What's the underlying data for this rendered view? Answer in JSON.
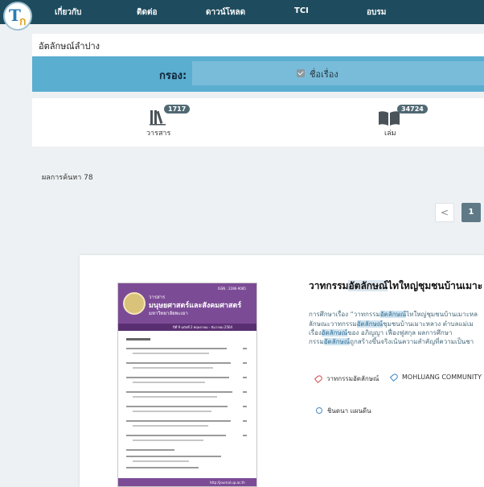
{
  "nav": {
    "items": [
      "เกี่ยวกับ",
      "ติดต่อ",
      "ดาวน์โหลด",
      "TCI",
      "อบรม"
    ]
  },
  "breadcrumb": "อัตลักษณ์ลำปาง",
  "filter": {
    "label": "กรอง:",
    "option": "ชื่อเรื่อง"
  },
  "categories": [
    {
      "label": "วารสาร",
      "count": "1717",
      "icon": "books-icon"
    },
    {
      "label": "เล่ม",
      "count": "34724",
      "icon": "open-book-icon"
    }
  ],
  "results": {
    "count_text": "ผลการค้นหา 78"
  },
  "pagination": {
    "prev": "<",
    "current": "1"
  },
  "cover": {
    "issn": "ISSN : 2286-9085",
    "line1": "วารสาร",
    "line2": "มนุษยศาสตร์และสังคมศาสตร์",
    "line3": "มหาวิทยาลัยพะเยา",
    "issue": "ปีที่ 9 ฉบับที่ 2 พฤษภาคม - ธันวาคม 2564",
    "footer": "http://journal.up.ac.th"
  },
  "result": {
    "title_pre": "วาทกรรม",
    "title_hl": "อัตลักษณ์",
    "title_post": "ไทใหญ่ชุมชนบ้านเมาะ",
    "abstract": [
      {
        "pre": "การศึกษาเรื่อง “วาทกรรม",
        "hl": "อัตลักษณ์",
        "post": "ไทใหญ่ชุมชนบ้านเมาะหล"
      },
      {
        "pre": "ลักษณะวาทกรรม",
        "hl": "อัตลักษณ์",
        "post": "ชุมชนบ้านเมาะหลวง ตำบลแม่เม"
      },
      {
        "pre": "เรื่อง",
        "hl": "อัตลักษณ์",
        "post": "ของ อภิญญา เฟื่องฟูสกุล ผลการศึกษา"
      },
      {
        "pre": "กรรม",
        "hl": "อัตลักษณ์",
        "post": "ถูกสร้างขึ้นจริงเน้นความสำคัญที่ความเป็นชา"
      }
    ],
    "tags": [
      "วาทกรรมอัตลักษณ์",
      "MOHLUANG COMMUNITY LA"
    ],
    "author": "ชินดนา แผนดีน"
  },
  "colors": {
    "nav_bg": "#1e4b5e",
    "filter_bg": "#5aaed0",
    "cover_purple": "#7c4b96",
    "page_active": "#5f7a86"
  }
}
